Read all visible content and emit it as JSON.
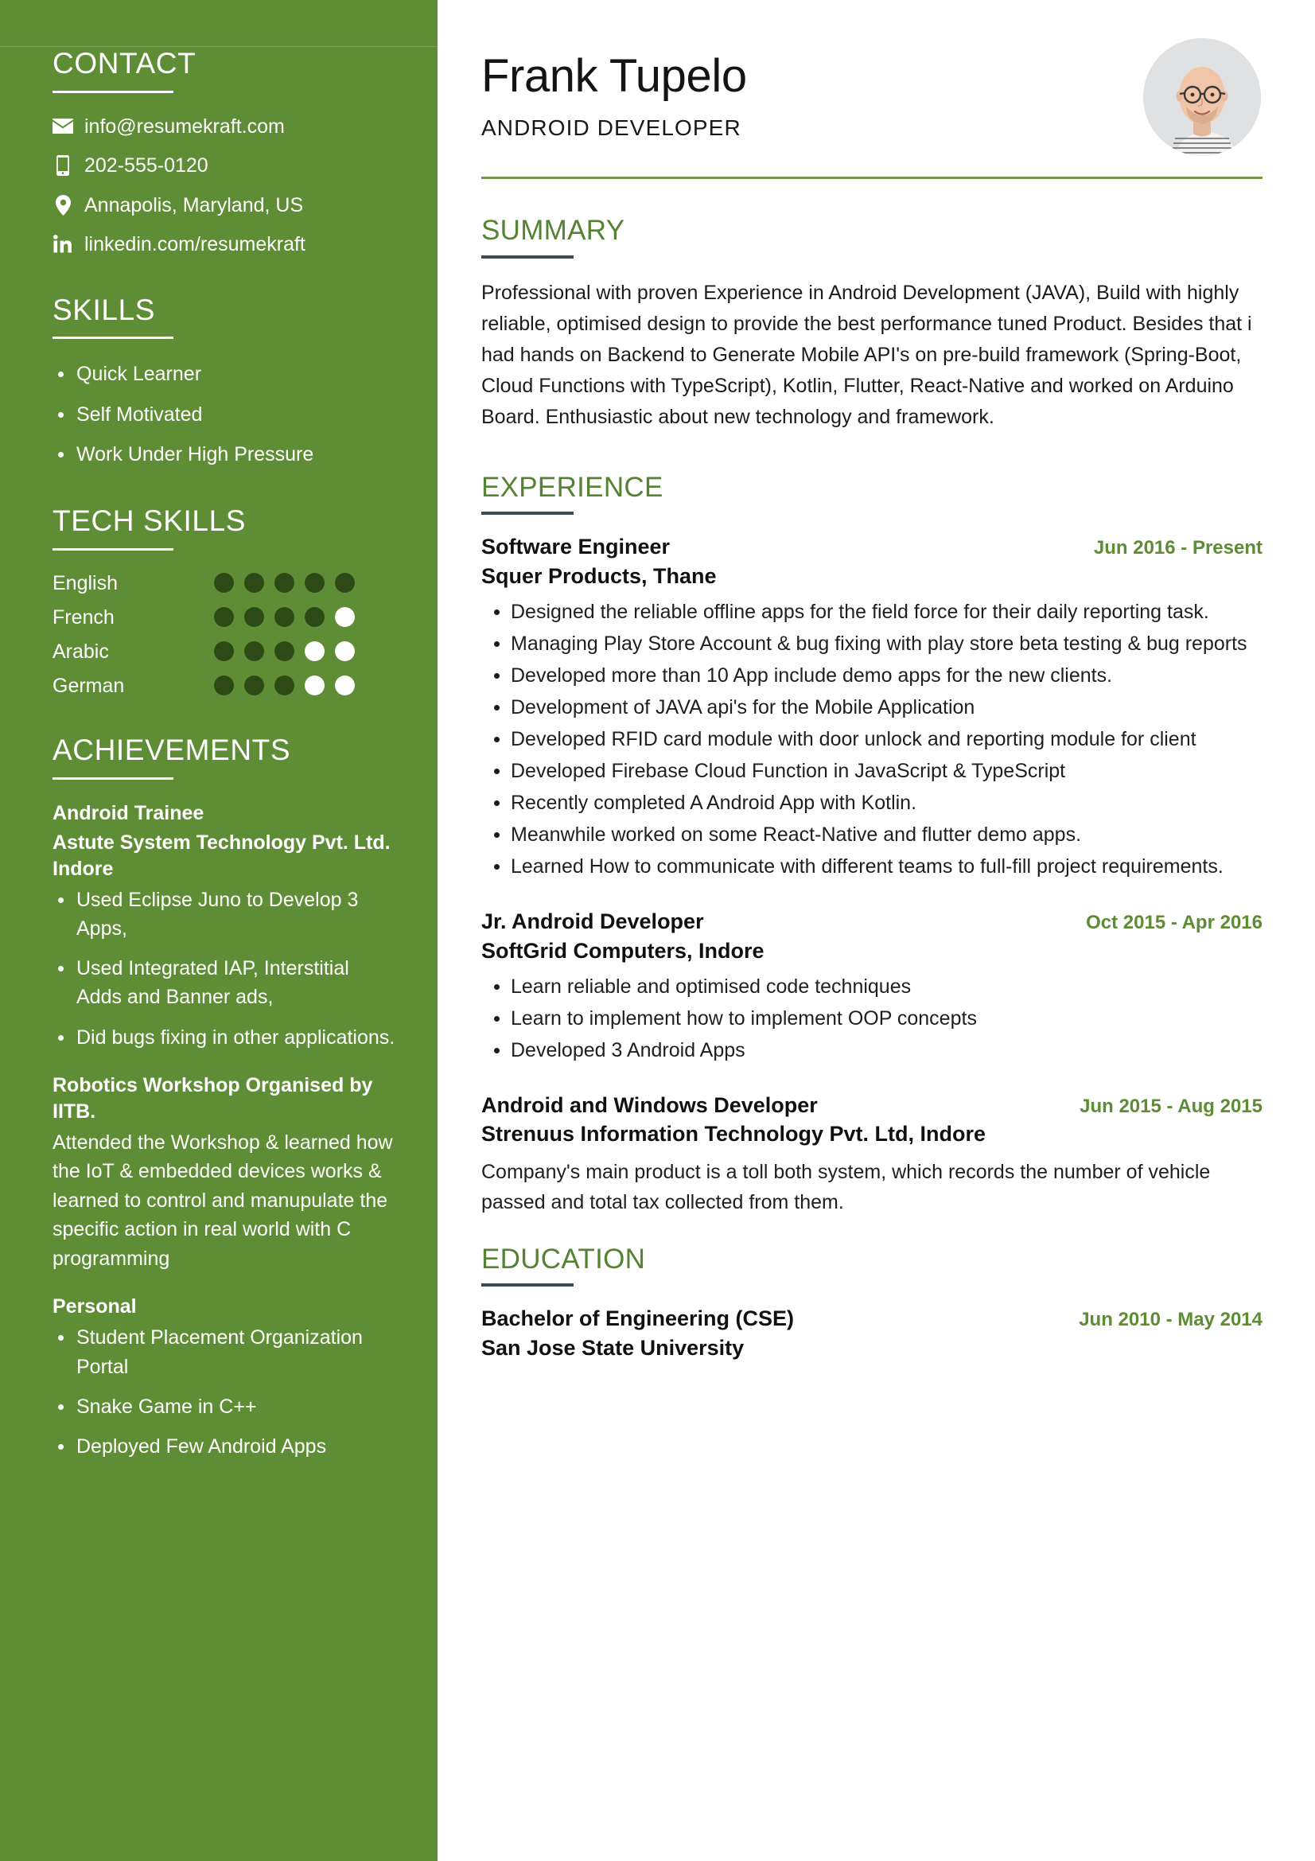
{
  "theme": {
    "sidebar_green": "#5f8d35",
    "heading_green": "#568234",
    "date_green": "#5d8c33",
    "dot_filled": "#2d4a16",
    "rule_dark": "#3c4a56"
  },
  "sidebar": {
    "contact": {
      "heading": "CONTACT",
      "items": [
        {
          "icon": "envelope-icon",
          "text": "info@resumekraft.com"
        },
        {
          "icon": "mobile-phone-icon",
          "text": "202-555-0120"
        },
        {
          "icon": "location-pin-icon",
          "text": "Annapolis, Maryland, US"
        },
        {
          "icon": "linkedin-icon",
          "text": "linkedin.com/resumekraft"
        }
      ]
    },
    "skills": {
      "heading": "SKILLS",
      "items": [
        "Quick Learner",
        "Self Motivated",
        "Work Under High Pressure"
      ]
    },
    "tech_skills": {
      "heading": "TECH SKILLS",
      "max": 5,
      "items": [
        {
          "label": "English",
          "level": 5
        },
        {
          "label": "French",
          "level": 4
        },
        {
          "label": "Arabic",
          "level": 3
        },
        {
          "label": "German",
          "level": 3
        }
      ]
    },
    "achievements": {
      "heading": "ACHIEVEMENTS",
      "blocks": [
        {
          "title": "Android Trainee",
          "subtitle": "Astute System Technology Pvt. Ltd. Indore",
          "bullets": [
            "Used Eclipse Juno to Develop 3 Apps,",
            "Used Integrated IAP, Interstitial Adds and Banner ads,",
            "Did bugs fixing in other applications."
          ]
        },
        {
          "title": "Robotics Workshop Organised by IITB.",
          "body": "Attended the Workshop & learned how the IoT & embedded devices works & learned to control and manupulate the specific action in real world with C programming"
        },
        {
          "title": "Personal",
          "bullets": [
            "Student Placement Organization Portal",
            "Snake Game in C++",
            "Deployed Few Android Apps"
          ]
        }
      ]
    }
  },
  "main": {
    "name": "Frank Tupelo",
    "role": "ANDROID DEVELOPER",
    "summary": {
      "heading": "SUMMARY",
      "text": "Professional with proven Experience in Android Development (JAVA), Build with highly reliable, optimised design to provide the best performance tuned Product. Besides that i had hands on Backend to Generate Mobile API's on pre-build framework (Spring-Boot, Cloud Functions with TypeScript), Kotlin, Flutter, React-Native and worked on Arduino Board. Enthusiastic about new technology and framework."
    },
    "experience": {
      "heading": "EXPERIENCE",
      "jobs": [
        {
          "title": "Software Engineer",
          "company": "Squer Products, Thane",
          "date": "Jun 2016 - Present",
          "bullets": [
            "Designed the reliable offline apps for the field force for their daily reporting task.",
            "Managing Play Store Account & bug fixing with play store beta testing & bug reports",
            "Developed more than 10 App include demo apps for the new clients.",
            "Development of JAVA api's for the Mobile Application",
            "Developed RFID card module with door unlock and reporting module for client",
            "Developed Firebase Cloud Function in JavaScript & TypeScript",
            "Recently completed A Android App with Kotlin.",
            "Meanwhile worked on some React-Native and flutter demo apps.",
            "Learned How to communicate with different teams to full-fill project requirements."
          ]
        },
        {
          "title": "Jr. Android Developer",
          "company": "SoftGrid Computers, Indore",
          "date": "Oct 2015 - Apr 2016",
          "bullets": [
            "Learn reliable and optimised code techniques",
            "Learn to implement how to implement OOP concepts",
            "Developed 3 Android Apps"
          ]
        },
        {
          "title": "Android and Windows Developer",
          "company": "Strenuus Information Technology Pvt. Ltd, Indore",
          "date": "Jun 2015 - Aug 2015",
          "description": "Company's main product is a toll both system, which records the number of vehicle passed and total tax collected from them."
        }
      ]
    },
    "education": {
      "heading": "EDUCATION",
      "items": [
        {
          "degree": "Bachelor of Engineering (CSE)",
          "school": "San Jose State University",
          "date": "Jun 2010 - May 2014"
        }
      ]
    }
  }
}
